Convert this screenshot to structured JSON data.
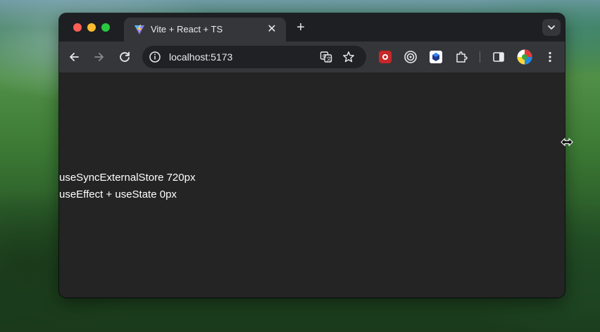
{
  "browser": {
    "tab": {
      "title": "Vite + React + TS",
      "favicon": "vite-logo"
    },
    "omnibox": {
      "url": "localhost:5173"
    },
    "toolbar_icons": [
      "back-icon",
      "forward-icon",
      "reload-icon",
      "site-info-icon",
      "translate-icon",
      "bookmark-star-icon"
    ],
    "extensions": [
      "red-extension-icon",
      "target-extension-icon",
      "cube-extension-icon",
      "puzzle-extensions-icon",
      "side-panel-icon",
      "profile-avatar",
      "kebab-menu-icon"
    ]
  },
  "page": {
    "lines": [
      "useSyncExternalStore 720px",
      "useEffect + useState 0px"
    ]
  },
  "colors": {
    "page_background": "#242424",
    "page_text": "#ffffff",
    "tab_active": "#35363a",
    "tabstrip": "#1e1f22"
  }
}
